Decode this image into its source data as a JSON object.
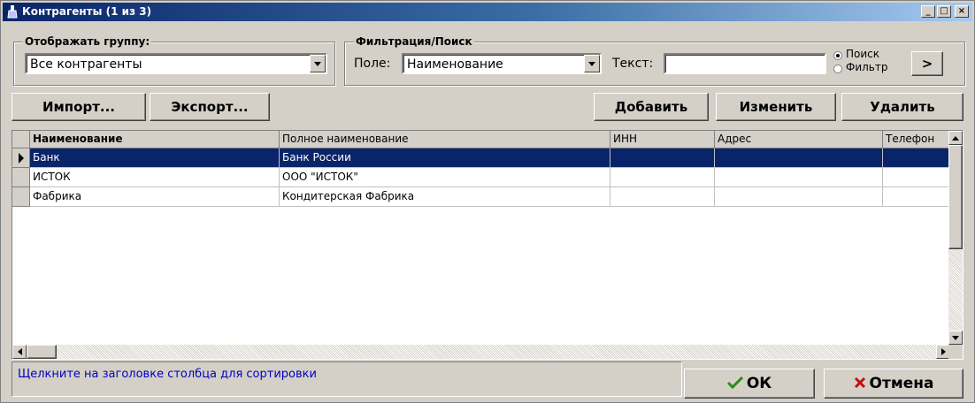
{
  "window": {
    "title": "Контрагенты (1 из 3)",
    "controls": {
      "minimize": "_",
      "maximize": "□",
      "close": "×"
    }
  },
  "group_filter": {
    "label": "Отображать группу:",
    "value": "Все контрагенты"
  },
  "search": {
    "label": "Фильтрация/Поиск",
    "field_label": "Поле:",
    "field_value": "Наименование",
    "text_label": "Текст:",
    "text_value": "",
    "mode_search": "Поиск",
    "mode_filter": "Фильтр",
    "go_button": ">"
  },
  "toolbar": {
    "import": "Импорт...",
    "export": "Экспорт...",
    "add": "Добавить",
    "edit": "Изменить",
    "delete": "Удалить"
  },
  "table": {
    "columns": [
      "Наименование",
      "Полное наименование",
      "ИНН",
      "Адрес",
      "Телефон"
    ],
    "rows": [
      [
        "Банк",
        "Банк России",
        "",
        "",
        ""
      ],
      [
        "ИСТОК",
        "ООО \"ИСТОК\"",
        "",
        "",
        ""
      ],
      [
        "Фабрика",
        "Кондитерская Фабрика",
        "",
        "",
        ""
      ]
    ]
  },
  "status_text": "Щелкните на заголовке столбца для сортировки",
  "buttons": {
    "ok": "ОК",
    "cancel": "Отмена"
  },
  "colors": {
    "selection": "#0a246a",
    "title_start": "#0a246a",
    "ok_check": "#2a8c1a",
    "cancel_x": "#c01010",
    "status_text": "#0000c0"
  }
}
